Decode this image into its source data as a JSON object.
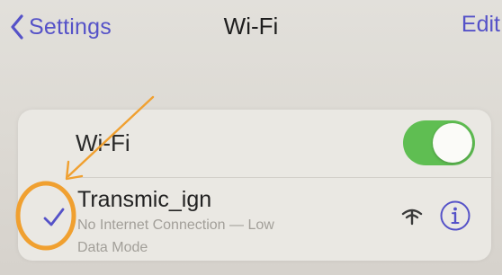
{
  "nav": {
    "back_label": "Settings",
    "title": "Wi-Fi",
    "edit_label": "Edit"
  },
  "wifi_row": {
    "label": "Wi-Fi",
    "toggle_on": true
  },
  "network": {
    "name": "Transmic_ign",
    "status_line1": "No Internet Connection — Low",
    "status_line2": "Data Mode",
    "connected": true
  },
  "icons": {
    "back": "chevron-left-icon",
    "checkmark": "checkmark-icon",
    "signal": "wifi-no-internet-icon",
    "info": "info-circle-icon"
  },
  "colors": {
    "accent": "#5552c8",
    "toggle_on": "#5fbe52",
    "status_text": "#a29f99",
    "annotation": "#f0a030"
  }
}
